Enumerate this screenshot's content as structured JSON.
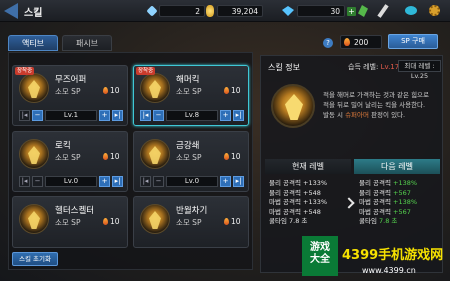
{
  "header": {
    "title": "스킬",
    "resources": [
      {
        "icon": "feather-icon",
        "color": "#8fd3ff",
        "value": "2"
      },
      {
        "icon": "gold-coin-icon",
        "color": "#f0c33c",
        "value": "39,204"
      },
      {
        "icon": "diamond-icon",
        "color": "#57c4ff",
        "value": "30"
      }
    ]
  },
  "tabs": [
    {
      "label": "액티브"
    },
    {
      "label": "패시브"
    }
  ],
  "help_label": "?",
  "sp": {
    "value": "200",
    "buy_label": "SP 구매"
  },
  "skills": [
    {
      "badge": "장착중",
      "name": "무즈어퍼",
      "cost_label": "소모 SP",
      "cost": "10",
      "level": "Lv.1"
    },
    {
      "badge": "장착중",
      "name": "해머킥",
      "cost_label": "소모 SP",
      "cost": "10",
      "level": "Lv.8"
    },
    {
      "badge": "",
      "name": "로킥",
      "cost_label": "소모 SP",
      "cost": "10",
      "level": "Lv.0"
    },
    {
      "badge": "",
      "name": "금강쇄",
      "cost_label": "소모 SP",
      "cost": "10",
      "level": "Lv.0"
    },
    {
      "badge": "",
      "name": "헬터스켈터",
      "cost_label": "소모 SP",
      "cost": "10",
      "level": "Lv.0"
    },
    {
      "badge": "",
      "name": "반월차기",
      "cost_label": "소모 SP",
      "cost": "10",
      "level": "Lv.0"
    }
  ],
  "reset_label": "스킬 초기화",
  "info": {
    "title": "스킬 정보",
    "learn_label": "습득 레벨:",
    "learn_value": "Lv.17",
    "max_level": "최대 레벨 : Lv.25",
    "desc_line1": "적을 해머로 가격하는 것과 같은 힘으로",
    "desc_line2": "적을 뒤로 밀어 날리는 킥을 사용한다.",
    "desc_line3_pre": "발동 시 ",
    "desc_line3_hl": "슈퍼아머",
    "desc_line3_post": " 판정이 있다.",
    "current_label": "현재 레벨",
    "next_label": "다음 레벨",
    "current_stats": [
      {
        "k": "물리 공격력",
        "v": "+133%"
      },
      {
        "k": "물리 공격력",
        "v": "+548"
      },
      {
        "k": "마법 공격력",
        "v": "+133%"
      },
      {
        "k": "마법 공격력",
        "v": "+548"
      },
      {
        "k": "쿨타임",
        "v": "7.8 초"
      }
    ],
    "next_stats": [
      {
        "k": "물리 공격력",
        "v": "+138%"
      },
      {
        "k": "물리 공격력",
        "v": "+567"
      },
      {
        "k": "마법 공격력",
        "v": "+138%"
      },
      {
        "k": "마법 공격력",
        "v": "+567"
      },
      {
        "k": "쿨타임",
        "v": "7.8 초"
      }
    ]
  },
  "watermark": {
    "logo": "游戏\n大全",
    "brand": "4399手机游戏网",
    "url": "www.4399.cn"
  }
}
